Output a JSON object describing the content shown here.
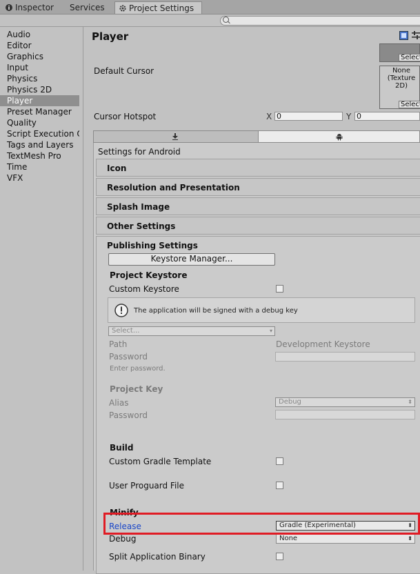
{
  "tabs": [
    {
      "label": "Inspector",
      "icon": "info-icon"
    },
    {
      "label": "Services"
    },
    {
      "label": "Project Settings",
      "icon": "gear-icon",
      "active": true
    }
  ],
  "sidebar": {
    "items": [
      {
        "label": "Audio"
      },
      {
        "label": "Editor"
      },
      {
        "label": "Graphics"
      },
      {
        "label": "Input"
      },
      {
        "label": "Physics"
      },
      {
        "label": "Physics 2D"
      },
      {
        "label": "Player",
        "selected": true
      },
      {
        "label": "Preset Manager"
      },
      {
        "label": "Quality"
      },
      {
        "label": "Script Execution O"
      },
      {
        "label": "Tags and Layers"
      },
      {
        "label": "TextMesh Pro"
      },
      {
        "label": "Time"
      },
      {
        "label": "VFX"
      }
    ]
  },
  "main": {
    "title": "Player",
    "default_cursor_label": "Default Cursor",
    "select_label": "Select",
    "cursor_texture": "None\n(Texture\n2D)",
    "cursor_hotspot_label": "Cursor Hotspot",
    "hotspot_x_label": "X",
    "hotspot_x": "0",
    "hotspot_y_label": "Y",
    "hotspot_y": "0",
    "settings_for": "Settings for Android",
    "sections": {
      "icon": "Icon",
      "resolution": "Resolution and Presentation",
      "splash": "Splash Image",
      "other": "Other Settings",
      "publishing": "Publishing Settings"
    },
    "keystore_manager_button": "Keystore Manager...",
    "project_keystore": "Project Keystore",
    "custom_keystore": "Custom Keystore",
    "debug_key_message": "The application will be signed with a debug key",
    "keystore_select": "Select...",
    "path_label": "Path",
    "path_value": "Development Keystore",
    "password_label": "Password",
    "enter_password": "Enter password.",
    "project_key": "Project Key",
    "alias_label": "Alias",
    "alias_value": "Debug",
    "key_password_label": "Password",
    "build": "Build",
    "custom_gradle": "Custom Gradle Template",
    "user_proguard": "User Proguard File",
    "minify": "Minify",
    "release_label": "Release",
    "release_value": "Gradle (Experimental)",
    "debug_label": "Debug",
    "debug_value": "None",
    "split_binary": "Split Application Binary"
  },
  "colors": {
    "highlight": "#e01b24",
    "release_text": "#1a46c8"
  }
}
